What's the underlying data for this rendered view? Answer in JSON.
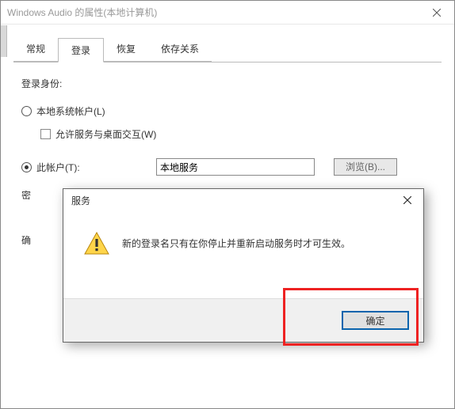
{
  "window": {
    "title": "Windows Audio 的属性(本地计算机)"
  },
  "tabs": {
    "general": "常规",
    "logon": "登录",
    "recovery": "恢复",
    "dependencies": "依存关系"
  },
  "logon_tab": {
    "identity_label": "登录身份:",
    "local_system": "本地系统帐户(L)",
    "allow_interact": "允许服务与桌面交互(W)",
    "this_account": "此帐户(T):",
    "account_value": "本地服务",
    "browse": "浏览(B)...",
    "password_label_truncated": "密",
    "confirm_label_truncated": "确"
  },
  "dialog": {
    "title": "服务",
    "message": "新的登录名只有在你停止并重新启动服务时才可生效。",
    "ok": "确定"
  }
}
